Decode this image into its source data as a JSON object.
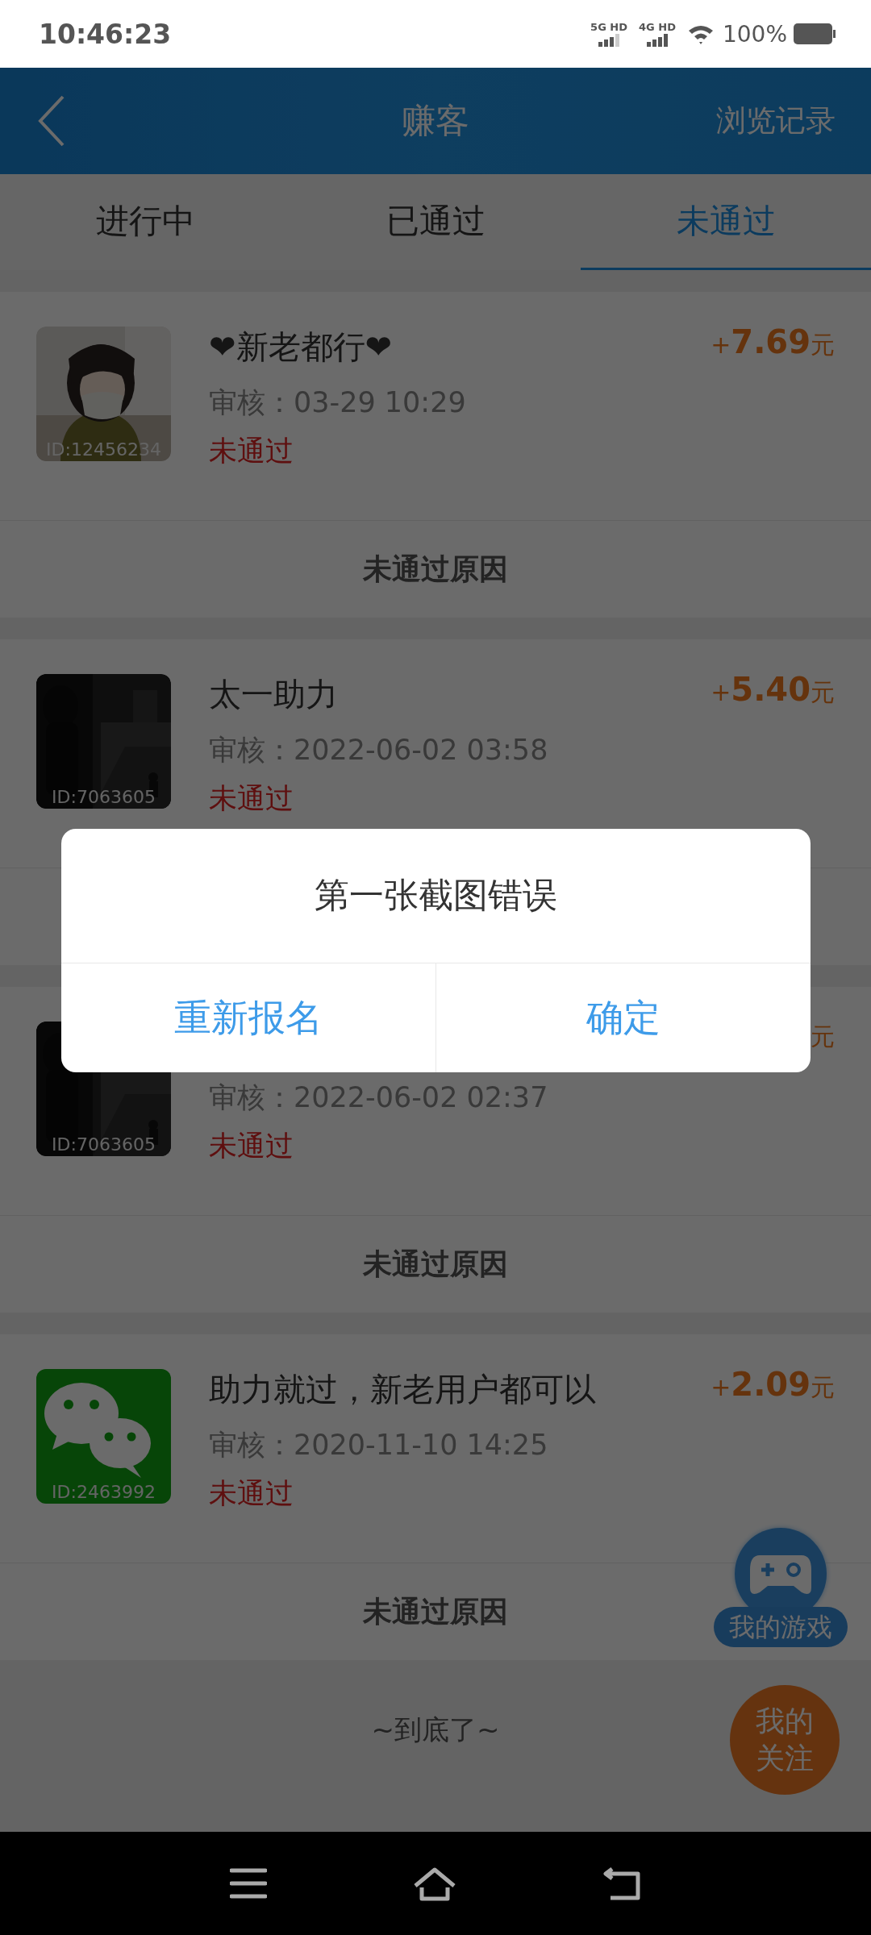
{
  "status_bar": {
    "time": "10:46:23",
    "network_labels": [
      "5G HD",
      "4G HD"
    ],
    "battery": "100%"
  },
  "header": {
    "title": "赚客",
    "action": "浏览记录"
  },
  "tabs": [
    {
      "label": "进行中",
      "selected": false
    },
    {
      "label": "已通过",
      "selected": false
    },
    {
      "label": "未通过",
      "selected": true
    }
  ],
  "tasks": [
    {
      "kind": "picture",
      "id_label": "ID:12456234",
      "title": "❤新老都行❤",
      "amount_sign": "+",
      "amount": "7.69",
      "unit": "元",
      "review": "审核：03-29 10:29",
      "status": "未通过",
      "reason_button": "未通过原因"
    },
    {
      "kind": "picture",
      "id_label": "ID:7063605",
      "title": "太一助力",
      "amount_sign": "+",
      "amount": "5.40",
      "unit": "元",
      "review": "审核：2022-06-02 03:58",
      "status": "未通过"
    },
    {
      "kind": "picture",
      "id_label": "ID:7063605",
      "unit": "元",
      "review": "审核：2022-06-02 02:37",
      "status": "未通过",
      "reason_button": "未通过原因"
    },
    {
      "kind": "chat",
      "id_label": "ID:2463992",
      "title": "助力就过，新老用户都可以",
      "amount_sign": "+",
      "amount": "2.09",
      "unit": "元",
      "review": "审核：2020-11-10 14:25",
      "status": "未通过",
      "reason_button": "未通过原因"
    }
  ],
  "footer": "~到底了~",
  "floating": {
    "game_label": "我的游戏",
    "follow_label": "我的关注"
  },
  "dialog": {
    "message": "第一张截图错误",
    "buttons": [
      "重新报名",
      "确定"
    ]
  }
}
